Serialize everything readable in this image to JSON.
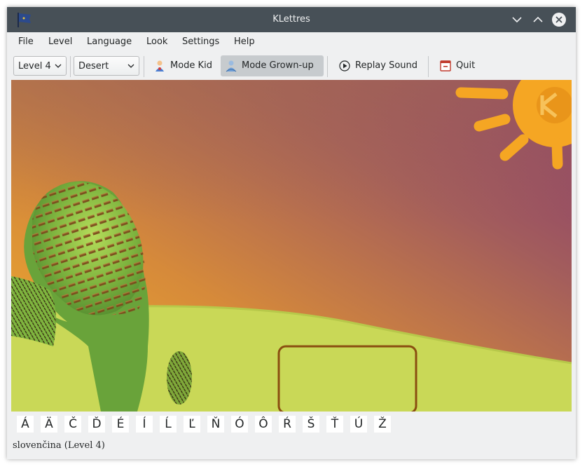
{
  "window": {
    "title": "KLettres"
  },
  "menu": [
    "File",
    "Level",
    "Language",
    "Look",
    "Settings",
    "Help"
  ],
  "toolbar": {
    "level_select": "Level 4",
    "theme_select": "Desert",
    "mode_kid": "Mode Kid",
    "mode_grownup": "Mode Grown-up",
    "replay": "Replay Sound",
    "quit": "Quit"
  },
  "special_letters": [
    "Á",
    "Ä",
    "Č",
    "Ď",
    "É",
    "Í",
    "Ĺ",
    "Ľ",
    "Ň",
    "Ó",
    "Ô",
    "Ŕ",
    "Š",
    "Ť",
    "Ú",
    "Ž"
  ],
  "status": {
    "text": "slovenčina  (Level 4)"
  },
  "colors": {
    "titlebar": "#475057",
    "sky_top_left": "#a46a52",
    "sky_top_right": "#8a3f6c",
    "horizon": "#f0b02e",
    "ground": "#c8d957",
    "sun": "#f5a623",
    "cactus": "#69a33a"
  }
}
